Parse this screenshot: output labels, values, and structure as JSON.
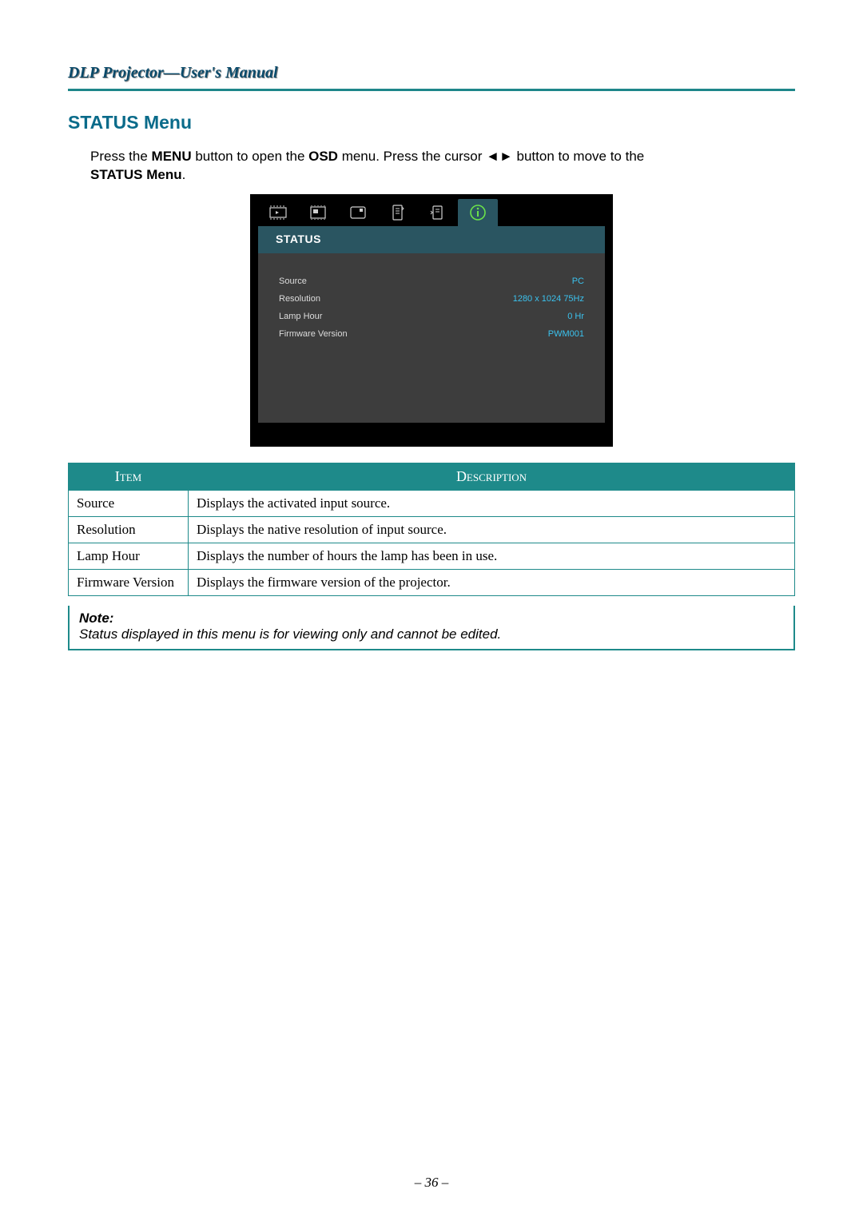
{
  "header": {
    "title": "DLP Projector—User's Manual"
  },
  "section": {
    "heading": "STATUS Menu"
  },
  "intro": {
    "pre1": "Press the ",
    "bold1": "MENU",
    "mid1": " button to open the ",
    "bold2": "OSD",
    "mid2": " menu. Press the cursor ◄► button to move to the ",
    "bold3": "STATUS Menu",
    "post": "."
  },
  "osd": {
    "title": "STATUS",
    "rows": [
      {
        "label": "Source",
        "value": "PC"
      },
      {
        "label": "Resolution",
        "value": "1280 x 1024 75Hz"
      },
      {
        "label": "Lamp Hour",
        "value": "0 Hr"
      },
      {
        "label": "Firmware Version",
        "value": "PWM001"
      }
    ]
  },
  "table": {
    "headers": {
      "item": "Item",
      "desc": "Description"
    },
    "rows": [
      {
        "item": "Source",
        "desc": "Displays the activated input source."
      },
      {
        "item": "Resolution",
        "desc": "Displays the native resolution of input source."
      },
      {
        "item": "Lamp Hour",
        "desc": "Displays the number of hours the lamp has been in use."
      },
      {
        "item": "Firmware Version",
        "desc": "Displays the firmware version of the projector."
      }
    ]
  },
  "note": {
    "label": "Note:",
    "text": "Status displayed in this menu is for viewing only and cannot be edited."
  },
  "footer": {
    "page": "– 36 –"
  }
}
